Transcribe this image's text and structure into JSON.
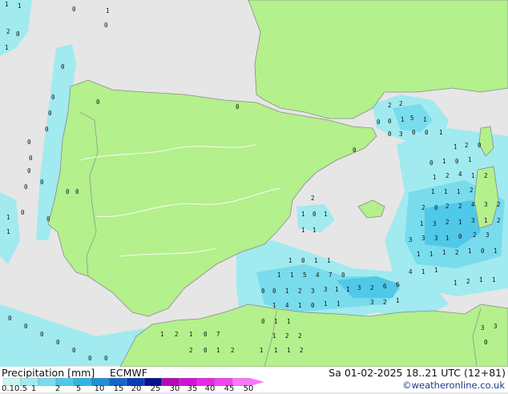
{
  "footer": {
    "title": "Precipitation [mm]",
    "model": "ECMWF",
    "datetime": "Sa 01-02-2025 18..21 UTC (12+81)",
    "credit": "©weatheronline.co.uk"
  },
  "legend": {
    "labels": [
      "0.1",
      "0.5",
      "1",
      "2",
      "5",
      "10",
      "15",
      "20",
      "25",
      "30",
      "35",
      "40",
      "45",
      "50"
    ],
    "colors": [
      "#c8f5f5",
      "#a0eaf0",
      "#78dcec",
      "#50c8e8",
      "#32b4e0",
      "#2090d8",
      "#1466c8",
      "#0a3cb4",
      "#08148c",
      "#b40ab4",
      "#d214d2",
      "#e628e6",
      "#f046f0",
      "#f878f8"
    ]
  },
  "map": {
    "colors": {
      "sea": "#e6e6e6",
      "land": "#b4f08c",
      "light_precip": "#a0eaf0",
      "medium_precip": "#78dcec",
      "heavy_precip": "#50c8e8",
      "border": "#8a8a8a"
    },
    "values": [
      "1",
      "1",
      "2",
      "0",
      "1",
      "0",
      "1",
      "0",
      "0",
      "0",
      "0",
      "0",
      "0",
      "0",
      "0",
      "0",
      "0",
      "0",
      "0",
      "0",
      "0",
      "1",
      "1",
      "0",
      "0",
      "2",
      "2",
      "0",
      "0",
      "1",
      "5",
      "1",
      "0",
      "3",
      "0",
      "0",
      "1",
      "1",
      "2",
      "0",
      "0",
      "1",
      "0",
      "1",
      "1",
      "2",
      "4",
      "1",
      "2",
      "0",
      "1",
      "1",
      "1",
      "2",
      "2",
      "0",
      "2",
      "2",
      "4",
      "3",
      "2",
      "1",
      "3",
      "2",
      "1",
      "3",
      "1",
      "2",
      "3",
      "3",
      "3",
      "1",
      "0",
      "2",
      "3",
      "1",
      "1",
      "1",
      "2",
      "1",
      "0",
      "1",
      "2",
      "1",
      "0",
      "1",
      "1",
      "1",
      "1",
      "1",
      "5",
      "4",
      "7",
      "0",
      "1",
      "0",
      "1",
      "1",
      "0",
      "0",
      "1",
      "2",
      "3",
      "3",
      "1",
      "1",
      "3",
      "2",
      "6",
      "6",
      "4",
      "1",
      "1",
      "1",
      "2",
      "1",
      "1",
      "1",
      "4",
      "1",
      "0",
      "1",
      "1",
      "3",
      "2",
      "1",
      "0",
      "1",
      "1",
      "1",
      "2",
      "1",
      "0",
      "7",
      "1",
      "2",
      "2",
      "2",
      "0",
      "1",
      "2",
      "1",
      "1",
      "1",
      "2",
      "3",
      "3",
      "0",
      "0",
      "0",
      "0",
      "0",
      "0",
      "0",
      "0"
    ]
  }
}
